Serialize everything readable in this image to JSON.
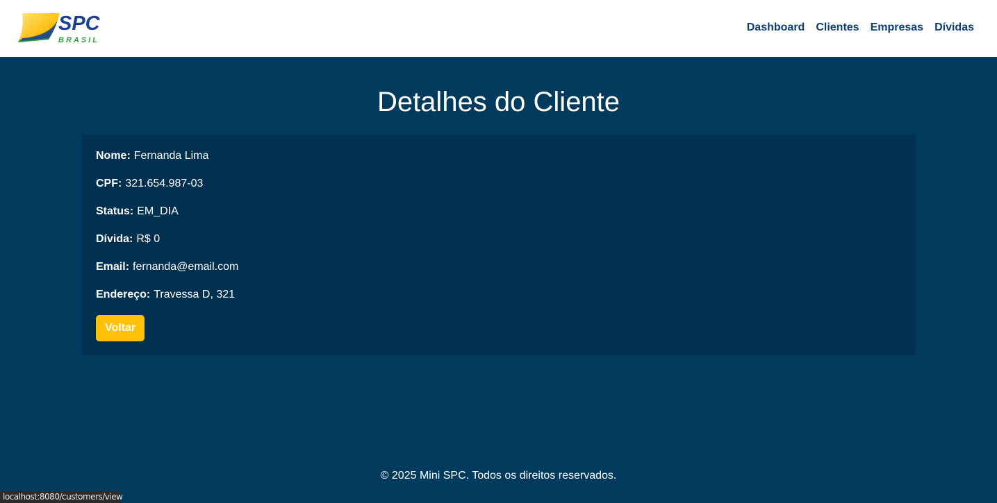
{
  "header": {
    "logo": {
      "text_main": "SPC",
      "text_sub": "BRASIL",
      "colors": {
        "blue": "#1c3f94",
        "green": "#2e9b3e",
        "yellow": "#fcc012"
      }
    },
    "nav": [
      {
        "label": "Dashboard"
      },
      {
        "label": "Clientes"
      },
      {
        "label": "Empresas"
      },
      {
        "label": "Dívidas"
      }
    ]
  },
  "main": {
    "title": "Detalhes do Cliente",
    "fields": [
      {
        "label": "Nome:",
        "value": "Fernanda Lima"
      },
      {
        "label": "CPF:",
        "value": "321.654.987-03"
      },
      {
        "label": "Status:",
        "value": "EM_DIA"
      },
      {
        "label": "Dívida:",
        "value": "R$ 0"
      },
      {
        "label": "Email:",
        "value": "fernanda@email.com"
      },
      {
        "label": "Endereço:",
        "value": "Travessa D, 321"
      }
    ],
    "back_button": "Voltar"
  },
  "footer": {
    "text": "© 2025 Mini SPC. Todos os direitos reservados."
  },
  "statusbar": {
    "url": "localhost:8080/customers/view"
  },
  "colors": {
    "background": "#003a5d",
    "card": "#00304f",
    "nav_link": "#0b3f73",
    "button": "#ffc107"
  }
}
